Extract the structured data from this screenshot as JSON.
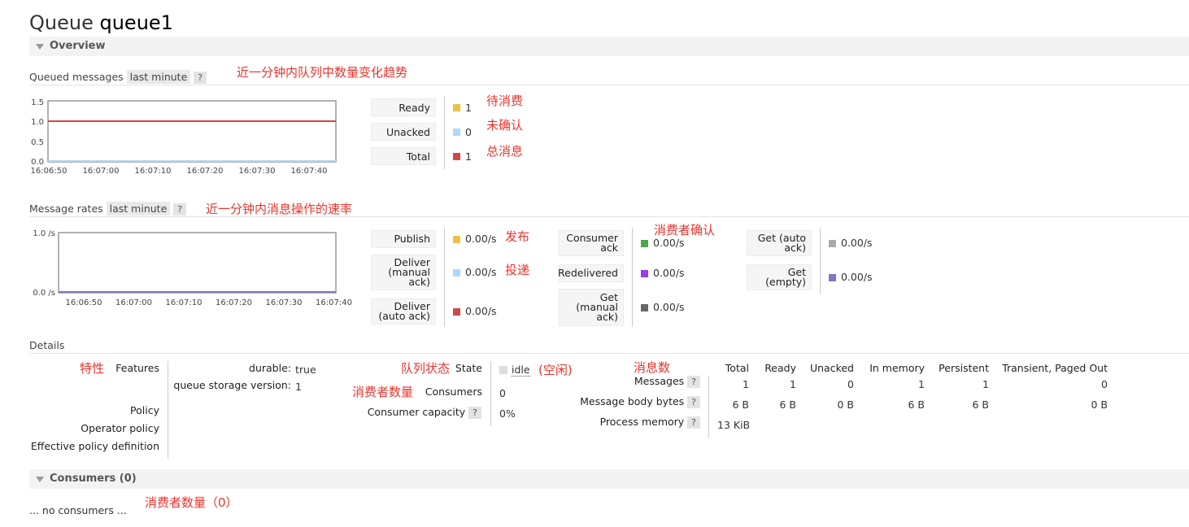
{
  "title": {
    "prefix": "Queue",
    "name": "queue1"
  },
  "overview": {
    "label": "Overview"
  },
  "queued": {
    "label": "Queued messages",
    "range": "last minute",
    "help": "?",
    "annotation": "近一分钟内队列中数量变化趋势",
    "y_ticks": [
      "1.5",
      "1.0",
      "0.5",
      "0.0"
    ],
    "x_ticks": [
      "16:06:50",
      "16:07:00",
      "16:07:10",
      "16:07:20",
      "16:07:30",
      "16:07:40"
    ],
    "legend": [
      {
        "label": "Ready",
        "value": "1",
        "color": "#edc240",
        "note": "待消费"
      },
      {
        "label": "Unacked",
        "value": "0",
        "color": "#afd8f8",
        "note": "未确认"
      },
      {
        "label": "Total",
        "value": "1",
        "color": "#cb4b4b",
        "note": "总消息"
      }
    ]
  },
  "rates": {
    "label": "Message rates",
    "range": "last minute",
    "help": "?",
    "annotation": "近一分钟内消息操作的速率",
    "y_ticks": [
      "1.0 /s",
      "0.0 /s"
    ],
    "x_ticks": [
      "16:06:50",
      "16:07:00",
      "16:07:10",
      "16:07:20",
      "16:07:30",
      "16:07:40"
    ],
    "col1": [
      {
        "label": "Publish",
        "value": "0.00/s",
        "color": "#edc240",
        "note": "发布"
      },
      {
        "label": "Deliver (manual ack)",
        "value": "0.00/s",
        "color": "#afd8f8",
        "note": "投递"
      },
      {
        "label": "Deliver (auto ack)",
        "value": "0.00/s",
        "color": "#cb4b4b",
        "note": ""
      }
    ],
    "col2": [
      {
        "label": "Consumer ack",
        "value": "0.00/s",
        "color": "#4da74d"
      },
      {
        "label": "Redelivered",
        "value": "0.00/s",
        "color": "#9440ed"
      },
      {
        "label": "Get (manual ack)",
        "value": "0.00/s",
        "color": "#666666"
      }
    ],
    "col2_note": "消费者确认",
    "col3": [
      {
        "label": "Get (auto ack)",
        "value": "0.00/s",
        "color": "#aaaaaa"
      },
      {
        "label": "Get (empty)",
        "value": "0.00/s",
        "color": "#7c79c3"
      }
    ]
  },
  "details": {
    "label": "Details",
    "features_note": "特性",
    "features_label": "Features",
    "durable_label": "durable:",
    "durable_value": "true",
    "storage_label": "queue storage version:",
    "storage_value": "1",
    "policy_label": "Policy",
    "operator_policy_label": "Operator policy",
    "effective_policy_label": "Effective policy definition",
    "state_note": "队列状态",
    "state_label": "State",
    "state_value": "idle",
    "state_value_note": "(空闲)",
    "consumers_note": "消费者数量",
    "consumers_label": "Consumers",
    "consumers_value": "0",
    "capacity_label": "Consumer capacity",
    "capacity_help": "?",
    "capacity_value": "0%",
    "messages_note": "消息数",
    "columns": [
      "Total",
      "Ready",
      "Unacked",
      "In memory",
      "Persistent",
      "Transient, Paged Out"
    ],
    "rows": [
      {
        "label": "Messages",
        "help": "?",
        "values": [
          "1",
          "1",
          "0",
          "1",
          "1",
          "0"
        ]
      },
      {
        "label": "Message body bytes",
        "help": "?",
        "values": [
          "6 B",
          "6 B",
          "0 B",
          "6 B",
          "6 B",
          "0 B"
        ]
      },
      {
        "label": "Process memory",
        "help": "?",
        "values": [
          "13 KiB"
        ]
      }
    ]
  },
  "consumers_section": {
    "label": "Consumers (0)",
    "empty_text": "... no consumers ...",
    "annotation": "消费者数量（0）"
  }
}
